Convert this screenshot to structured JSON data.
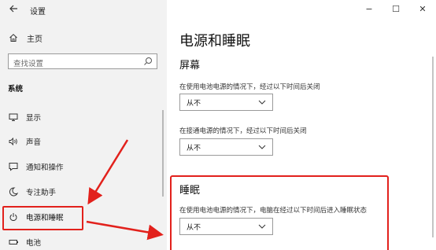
{
  "window": {
    "app_title": "设置",
    "back_icon": "back-arrow-icon",
    "controls": {
      "minimize": "−",
      "maximize": "☐",
      "close": "✕"
    }
  },
  "sidebar": {
    "home_label": "主页",
    "search_placeholder": "查找设置",
    "section_label": "系统",
    "items": [
      {
        "label": "显示",
        "icon": "monitor-icon"
      },
      {
        "label": "声音",
        "icon": "speaker-icon"
      },
      {
        "label": "通知和操作",
        "icon": "notification-icon"
      },
      {
        "label": "专注助手",
        "icon": "moon-icon"
      },
      {
        "label": "电源和睡眠",
        "icon": "power-icon",
        "selected": true
      },
      {
        "label": "电池",
        "icon": "battery-icon"
      }
    ]
  },
  "main": {
    "page_title": "电源和睡眠",
    "screen_heading": "屏幕",
    "screen_battery_label": "在使用电池电源的情况下，经过以下时间后关闭",
    "screen_battery_value": "从不",
    "screen_plugged_label": "在接通电源的情况下，经过以下时间后关闭",
    "screen_plugged_value": "从不",
    "sleep_heading": "睡眠",
    "sleep_battery_label": "在使用电池电源的情况下，电脑在经过以下时间后进入睡眠状态",
    "sleep_battery_value": "从不"
  },
  "annotation_color": "#e2211c"
}
